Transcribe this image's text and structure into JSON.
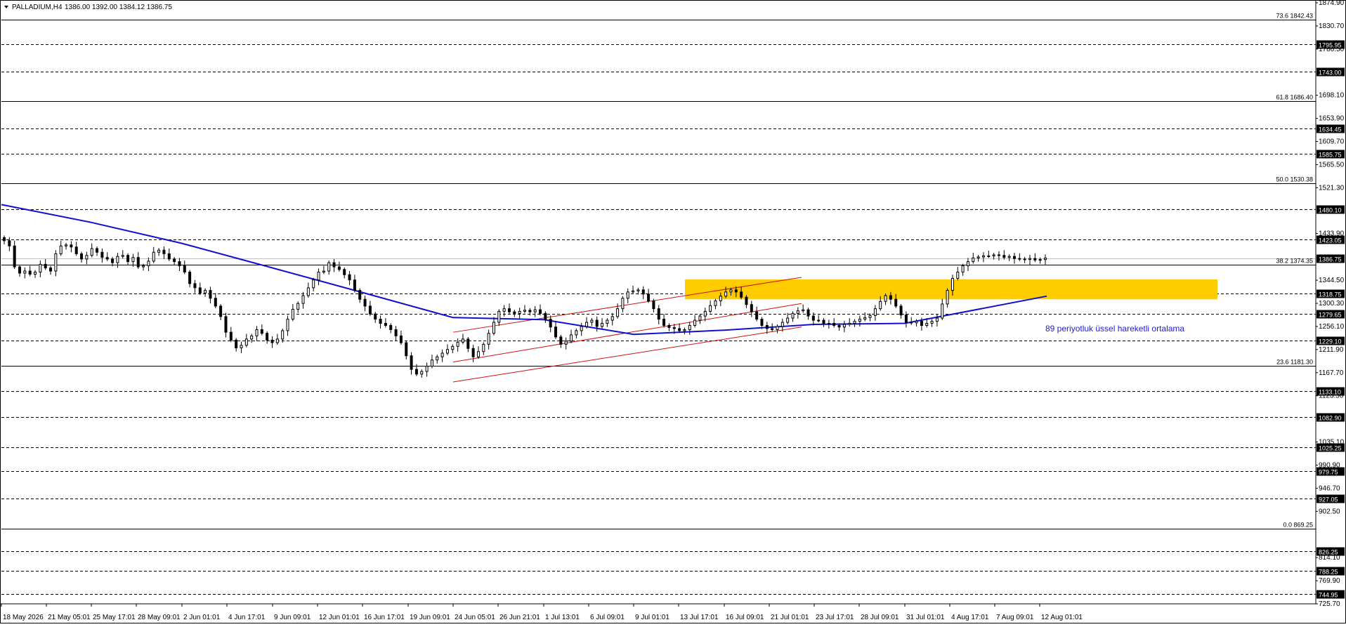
{
  "header": {
    "symbol_label": "PALLADIUM,H4",
    "ohlc": "1386.00 1392.00 1384.12 1386.75"
  },
  "colors": {
    "background": "#ffffff",
    "candles": "#000000",
    "ema": "#1010d0",
    "channel": "#d01010",
    "zone": "#ffcc00",
    "annotation": "#2020d0"
  },
  "chart_data": {
    "type": "candlestick",
    "symbol": "PALLADIUM",
    "timeframe": "H4",
    "ylim": [
      725.7,
      1874.9
    ],
    "y_ticks": [
      "1874.90",
      "1830.70",
      "1786.50",
      "1698.10",
      "1653.90",
      "1609.70",
      "1565.50",
      "1521.30",
      "1433.90",
      "1344.50",
      "1300.30",
      "1256.10",
      "1211.90",
      "1167.70",
      "1123.50",
      "1035.10",
      "990.90",
      "946.70",
      "902.50",
      "814.10",
      "769.90",
      "725.70"
    ],
    "x_ticks": [
      "18 May 2026",
      "21 May 05:01",
      "25 May 17:01",
      "28 May 09:01",
      "2 Jun 01:01",
      "4 Jun 17:01",
      "9 Jun 09:01",
      "12 Jun 01:01",
      "16 Jun 17:01",
      "19 Jun 09:01",
      "24 Jun 05:01",
      "26 Jun 21:01",
      "1 Jul 13:01",
      "6 Jul 09:01",
      "9 Jul 01:01",
      "13 Jul 17:01",
      "16 Jul 09:01",
      "21 Jul 01:01",
      "23 Jul 17:01",
      "28 Jul 09:01",
      "31 Jul 01:01",
      "4 Aug 17:01",
      "7 Aug 09:01",
      "12 Aug 01:01"
    ],
    "dashed_levels": [
      {
        "value": 1795.95,
        "label": "1795.95"
      },
      {
        "value": 1743.0,
        "label": "1743.00"
      },
      {
        "value": 1634.45,
        "label": "1634.45"
      },
      {
        "value": 1585.75,
        "label": "1585.75"
      },
      {
        "value": 1480.1,
        "label": "1480.10"
      },
      {
        "value": 1423.05,
        "label": "1423.05"
      },
      {
        "value": 1318.75,
        "label": "1318.75"
      },
      {
        "value": 1279.65,
        "label": "1279.65"
      },
      {
        "value": 1229.1,
        "label": "1229.10"
      },
      {
        "value": 1133.1,
        "label": "1133.10"
      },
      {
        "value": 1082.9,
        "label": "1082.90"
      },
      {
        "value": 1025.25,
        "label": "1025.25"
      },
      {
        "value": 979.75,
        "label": "979.75"
      },
      {
        "value": 927.05,
        "label": "927.05"
      },
      {
        "value": 826.25,
        "label": "826.25"
      },
      {
        "value": 788.25,
        "label": "788.25"
      },
      {
        "value": 744.95,
        "label": "744.95"
      }
    ],
    "fib_levels": [
      {
        "value": 1842.43,
        "label": "73.6 1842.43"
      },
      {
        "value": 1686.4,
        "label": "61.8 1686.40"
      },
      {
        "value": 1530.38,
        "label": "50.0 1530.38"
      },
      {
        "value": 1374.35,
        "label": "38.2 1374.35"
      },
      {
        "value": 1181.3,
        "label": "23.6 1181.30"
      },
      {
        "value": 869.25,
        "label": "0.0 869.25"
      }
    ],
    "current_price": {
      "value": 1386.75,
      "label": "1386.75"
    },
    "zone": {
      "low": 1308.0,
      "high": 1346.0
    },
    "ema_period": 89,
    "annotation": "89 periyotluk üssel hareketli ortalama",
    "closes": [
      1420,
      1410,
      1370,
      1358,
      1362,
      1356,
      1360,
      1375,
      1368,
      1362,
      1395,
      1410,
      1412,
      1408,
      1395,
      1385,
      1392,
      1405,
      1398,
      1388,
      1385,
      1378,
      1390,
      1392,
      1380,
      1388,
      1370,
      1372,
      1381,
      1398,
      1402,
      1395,
      1385,
      1380,
      1372,
      1360,
      1338,
      1330,
      1320,
      1325,
      1310,
      1295,
      1275,
      1245,
      1230,
      1215,
      1220,
      1232,
      1238,
      1250,
      1243,
      1230,
      1225,
      1232,
      1248,
      1270,
      1289,
      1300,
      1315,
      1330,
      1345,
      1360,
      1362,
      1378,
      1370,
      1365,
      1355,
      1345,
      1325,
      1308,
      1295,
      1280,
      1270,
      1262,
      1258,
      1250,
      1238,
      1225,
      1200,
      1174,
      1165,
      1170,
      1180,
      1192,
      1198,
      1205,
      1212,
      1218,
      1226,
      1232,
      1214,
      1198,
      1208,
      1222,
      1243,
      1264,
      1285,
      1290,
      1284,
      1281,
      1285,
      1287,
      1284,
      1288,
      1281,
      1270,
      1255,
      1236,
      1222,
      1228,
      1240,
      1248,
      1256,
      1264,
      1268,
      1256,
      1262,
      1268,
      1275,
      1290,
      1310,
      1322,
      1324,
      1326,
      1318,
      1305,
      1290,
      1270,
      1258,
      1254,
      1252,
      1248,
      1250,
      1258,
      1268,
      1276,
      1285,
      1296,
      1305,
      1314,
      1322,
      1326,
      1322,
      1312,
      1298,
      1284,
      1270,
      1258,
      1252,
      1250,
      1256,
      1264,
      1272,
      1281,
      1286,
      1288,
      1276,
      1268,
      1268,
      1262,
      1262,
      1258,
      1255,
      1260,
      1262,
      1266,
      1270,
      1273,
      1277,
      1290,
      1304,
      1315,
      1308,
      1295,
      1278,
      1264,
      1263,
      1266,
      1258,
      1262,
      1266,
      1272,
      1299,
      1325,
      1348,
      1360,
      1372,
      1380,
      1387,
      1389,
      1391,
      1391,
      1393,
      1392,
      1388,
      1390,
      1386,
      1385,
      1384,
      1386,
      1383,
      1384,
      1386.75
    ],
    "ema": [
      {
        "date": "18 May",
        "value": 1489
      },
      {
        "date": "25 May",
        "value": 1455
      },
      {
        "date": "2 Jun",
        "value": 1415
      },
      {
        "date": "9 Jun",
        "value": 1368
      },
      {
        "date": "16 Jun",
        "value": 1321
      },
      {
        "date": "24 Jun",
        "value": 1273
      },
      {
        "date": "1 Jul",
        "value": 1269
      },
      {
        "date": "9 Jul",
        "value": 1241
      },
      {
        "date": "16 Jul",
        "value": 1249
      },
      {
        "date": "23 Jul",
        "value": 1260
      },
      {
        "date": "31 Jul",
        "value": 1262
      },
      {
        "date": "12 Aug",
        "value": 1314
      }
    ],
    "channel": {
      "upper": [
        {
          "date": "24 Jun",
          "value": 1245
        },
        {
          "date": "21 Jul",
          "value": 1350
        }
      ],
      "middle": [
        {
          "date": "24 Jun",
          "value": 1188
        },
        {
          "date": "21 Jul",
          "value": 1300
        }
      ],
      "lower": [
        {
          "date": "24 Jun",
          "value": 1150
        },
        {
          "date": "21 Jul",
          "value": 1255
        }
      ]
    }
  }
}
